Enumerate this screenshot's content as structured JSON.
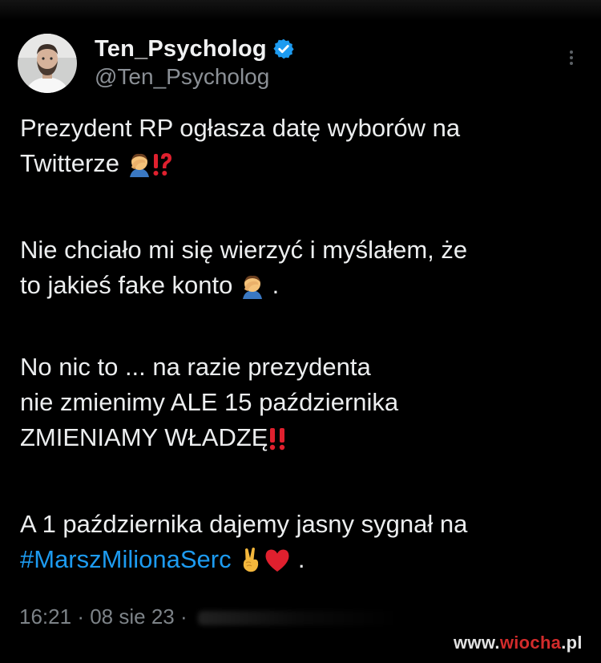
{
  "author": {
    "name": "Ten_Psycholog",
    "handle": "@Ten_Psycholog",
    "verified": true,
    "avatar_icon": "avatar-photo"
  },
  "tweet": {
    "lines": [
      "Prezydent RP ogłasza datę wyborów na",
      "Twitterze",
      "Nie chciało mi się wierzyć i myślałem, że",
      "to jakieś fake konto",
      ".",
      "No nic to ... na razie prezydenta",
      "nie zmienimy ALE 15 października",
      "ZMIENIAMY WŁADZĘ",
      "A 1 października dajemy jasny sygnał na",
      "#MarszMilionaSerc",
      "."
    ],
    "emojis": [
      "facepalm-icon",
      "exclamation-question-icon",
      "facepalm-icon",
      "double-exclamation-icon",
      "victory-hand-icon",
      "red-heart-icon"
    ]
  },
  "meta": {
    "time": "16:21",
    "separator": "·",
    "date": "08 sie 23"
  },
  "watermark": {
    "prefix": "www.",
    "brand": "wiocha",
    "suffix": ".pl"
  },
  "colors": {
    "background": "#000000",
    "text": "#e7e9ea",
    "muted": "#7d8388",
    "link": "#1d9bf0",
    "verified": "#1d9bf0",
    "emoji_red": "#e0202e"
  }
}
